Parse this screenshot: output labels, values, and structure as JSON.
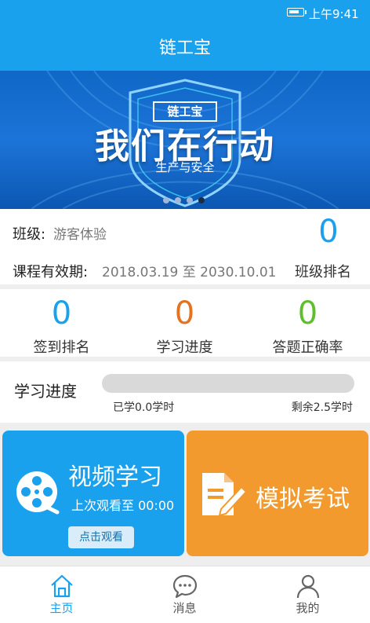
{
  "status_bar": {
    "time": "上午9:41",
    "battery_icon": "battery-icon"
  },
  "app": {
    "title": "链工宝"
  },
  "banner": {
    "badge": "链工宝",
    "headline": "我们在行动",
    "subtitle": "生产与安全",
    "page_count": 4,
    "active_index": 3
  },
  "class_info": {
    "class_label": "班级:",
    "class_value": "游客体验",
    "validity_label": "课程有效期:",
    "validity_value": "2018.03.19 至 2030.10.01",
    "rank_value": "0",
    "rank_label": "班级排名"
  },
  "stats": [
    {
      "value": "0",
      "label": "签到排名",
      "color": "#1aa1ee"
    },
    {
      "value": "0",
      "label": "学习进度",
      "color": "#e37222"
    },
    {
      "value": "0",
      "label": "答题正确率",
      "color": "#5fbe2b"
    }
  ],
  "progress": {
    "title": "学习进度",
    "fraction": 0,
    "learned_text": "已学0.0学时",
    "remaining_text": "剩余2.5学时"
  },
  "cards": {
    "video": {
      "title": "视频学习",
      "last_watched": "上次观看至 00:00",
      "button": "点击观看",
      "icon": "film-reel-icon",
      "color": "#1aa1ee"
    },
    "exam": {
      "title": "模拟考试",
      "icon": "document-pen-icon",
      "color": "#f29a2e"
    }
  },
  "tabbar": {
    "items": [
      {
        "label": "主页",
        "icon": "home-icon",
        "active": true
      },
      {
        "label": "消息",
        "icon": "chat-icon",
        "active": false
      },
      {
        "label": "我的",
        "icon": "user-icon",
        "active": false
      }
    ],
    "active_color": "#1aa1ee"
  }
}
